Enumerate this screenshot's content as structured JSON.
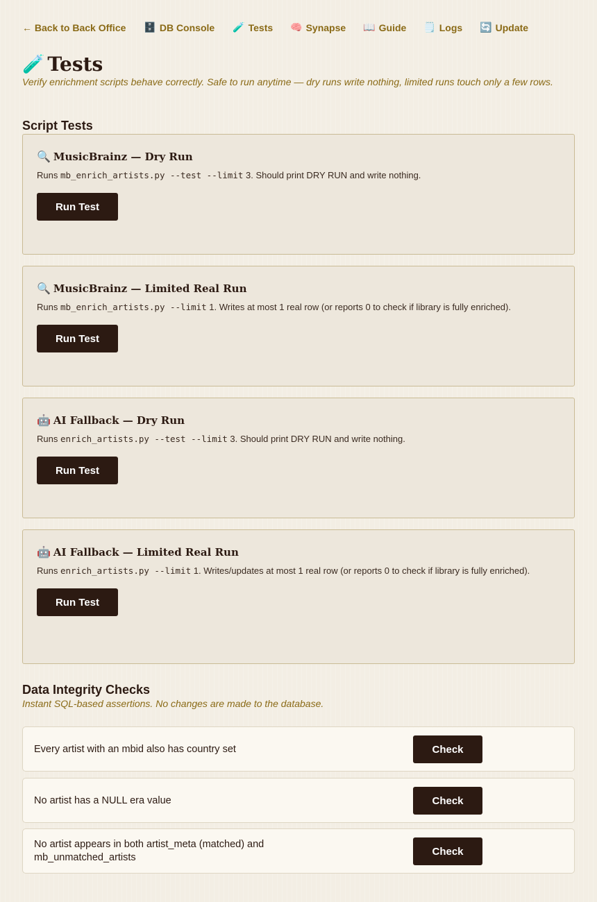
{
  "nav": {
    "back": {
      "icon": "",
      "label": "← Back to Back Office"
    },
    "db": {
      "icon": "🗄️",
      "label": "DB Console"
    },
    "tests": {
      "icon": "🧪",
      "label": "Tests"
    },
    "synapse": {
      "icon": "🧠",
      "label": "Synapse"
    },
    "guide": {
      "icon": "📖",
      "label": "Guide"
    },
    "logs": {
      "icon": "🗒️",
      "label": "Logs"
    },
    "update": {
      "icon": "🔄",
      "label": "Update"
    }
  },
  "page": {
    "icon": "🧪",
    "title": "Tests",
    "subtitle": "Verify enrichment scripts behave correctly. Safe to run anytime — dry runs write nothing, limited runs touch only a few rows."
  },
  "script_tests": {
    "heading": "Script Tests",
    "cards": [
      {
        "icon": "🔍",
        "title": "MusicBrainz — Dry Run",
        "desc_prefix": "Runs ",
        "desc_code": "mb_enrich_artists.py --test --limit",
        "desc_suffix": " 3. Should print DRY RUN and write nothing.",
        "button": "Run Test"
      },
      {
        "icon": "🔍",
        "title": "MusicBrainz — Limited Real Run",
        "desc_prefix": "Runs ",
        "desc_code": "mb_enrich_artists.py --limit",
        "desc_suffix": " 1. Writes at most 1 real row (or reports 0 to check if library is fully enriched).",
        "button": "Run Test"
      },
      {
        "icon": "🤖",
        "title": "AI Fallback — Dry Run",
        "desc_prefix": "Runs ",
        "desc_code": "enrich_artists.py --test --limit",
        "desc_suffix": " 3. Should print DRY RUN and write nothing.",
        "button": "Run Test"
      },
      {
        "icon": "🤖",
        "title": "AI Fallback — Limited Real Run",
        "desc_prefix": "Runs ",
        "desc_code": "enrich_artists.py --limit",
        "desc_suffix": " 1. Writes/updates at most 1 real row (or reports 0 to check if library is fully enriched).",
        "button": "Run Test"
      }
    ]
  },
  "integrity": {
    "heading": "Data Integrity Checks",
    "subtitle": "Instant SQL-based assertions. No changes are made to the database.",
    "checks": [
      {
        "text": "Every artist with an mbid also has country set",
        "button": "Check"
      },
      {
        "text": "No artist has a NULL era value",
        "button": "Check"
      },
      {
        "text": "No artist appears in both artist_meta (matched) and mb_unmatched_artists",
        "button": "Check"
      }
    ]
  }
}
